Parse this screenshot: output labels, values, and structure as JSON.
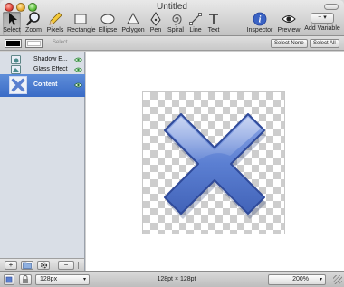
{
  "window": {
    "title": "Untitled"
  },
  "toolbar": {
    "tools": [
      {
        "label": "Select",
        "icon": "arrow-cursor-icon",
        "active": true
      },
      {
        "label": "Zoom",
        "icon": "magnifier-icon"
      },
      {
        "label": "Pixels",
        "icon": "pencil-icon"
      },
      {
        "label": "Rectangle",
        "icon": "rectangle-icon"
      },
      {
        "label": "Ellipse",
        "icon": "ellipse-icon"
      },
      {
        "label": "Polygon",
        "icon": "polygon-icon"
      },
      {
        "label": "Pen",
        "icon": "pen-icon"
      },
      {
        "label": "Spiral",
        "icon": "spiral-icon"
      },
      {
        "label": "Line",
        "icon": "line-icon"
      },
      {
        "label": "Text",
        "icon": "text-icon"
      },
      {
        "label": "Inspector",
        "icon": "info-icon"
      },
      {
        "label": "Preview",
        "icon": "eye-icon"
      },
      {
        "label": "Add Variable",
        "icon": "plus-dropdown-icon"
      }
    ],
    "add_variable_glyph": "+ ▾"
  },
  "options_bar": {
    "select_label": "Select",
    "select_none_label": "Select None",
    "select_all_label": "Select All",
    "stroke_color": "#000000",
    "fill_color": "#ffffff"
  },
  "layers": [
    {
      "name": "Shadow E...",
      "icon": "shadow-effect-icon"
    },
    {
      "name": "Glass Effect",
      "icon": "glass-effect-icon"
    },
    {
      "name": "Content",
      "icon": "content-layer-icon",
      "selected": true
    }
  ],
  "sidebar_buttons": {
    "add_glyph": "+",
    "minus_glyph": "−"
  },
  "status_bar": {
    "canvas_size_select": "128px",
    "dimensions": "128pt × 128pt",
    "zoom": "200%"
  },
  "colors": {
    "selection_blue": "#3a6bc6",
    "x_blue": "#5a7fcf",
    "visibility_green": "#2f8a3a"
  }
}
